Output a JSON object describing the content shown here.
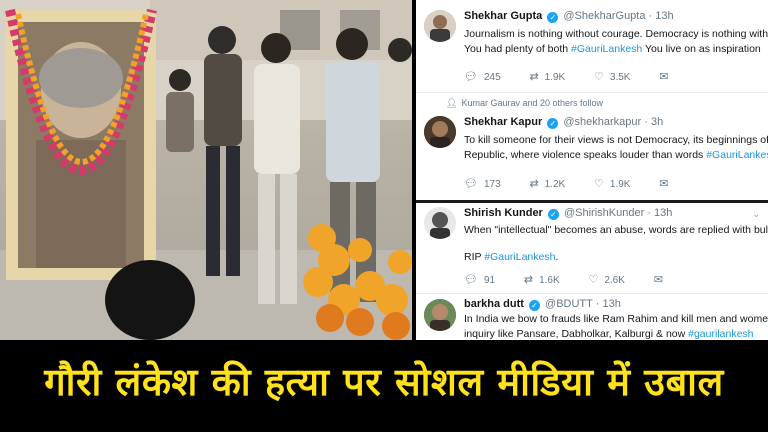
{
  "tweets": [
    {
      "name": "Shekhar Gupta",
      "handle": "@ShekharGupta",
      "time": "13h",
      "lines": [
        "Journalism is nothing without courage. Democracy is nothing without",
        "You had plenty of both "
      ],
      "hashtag": "#GauriLankesh",
      "after_hashtag": " You live on as inspiration",
      "replies": "245",
      "retweets": "1.9K",
      "likes": "3.5K"
    },
    {
      "context": "Kumar Gaurav and 20 others follow",
      "name": "Shekhar Kapur",
      "handle": "@shekharkapur",
      "time": "3h",
      "lines": [
        "To kill someone for their views is not Democracy, its beginnings of a B",
        "Republic, where violence speaks louder than words "
      ],
      "hashtag": "#GauriLankesh",
      "replies": "173",
      "retweets": "1.2K",
      "likes": "1.9K"
    },
    {
      "name": "Shirish Kunder",
      "handle": "@ShirishKunder",
      "time": "13h",
      "lines": [
        "When \"intellectual\" becomes an abuse, words are replied with bullet",
        "RIP "
      ],
      "hashtag": "#GauriLankesh",
      "after_hashtag": ".",
      "replies": "91",
      "retweets": "1.6K",
      "likes": "2.6K"
    },
    {
      "name": "barkha dutt",
      "handle": "@BDUTT",
      "time": "13h",
      "lines": [
        "In India we bow to frauds like Ram Rahim and kill men and women",
        "inquiry like Pansare, Dabholkar, Kalburgi & now "
      ],
      "hashtag": "#gaurilankesh"
    }
  ],
  "headline": "गौरी लंकेश की हत्या पर सोशल मीडिया में उबाल",
  "colors": {
    "headline": "#ffe21a",
    "hashtag": "#1b95e0",
    "verified": "#1da1f2",
    "banner_bg": "#000000"
  },
  "icons": [
    "reply-icon",
    "retweet-icon",
    "like-icon",
    "dm-icon",
    "verified-icon",
    "chevron-down-icon"
  ]
}
